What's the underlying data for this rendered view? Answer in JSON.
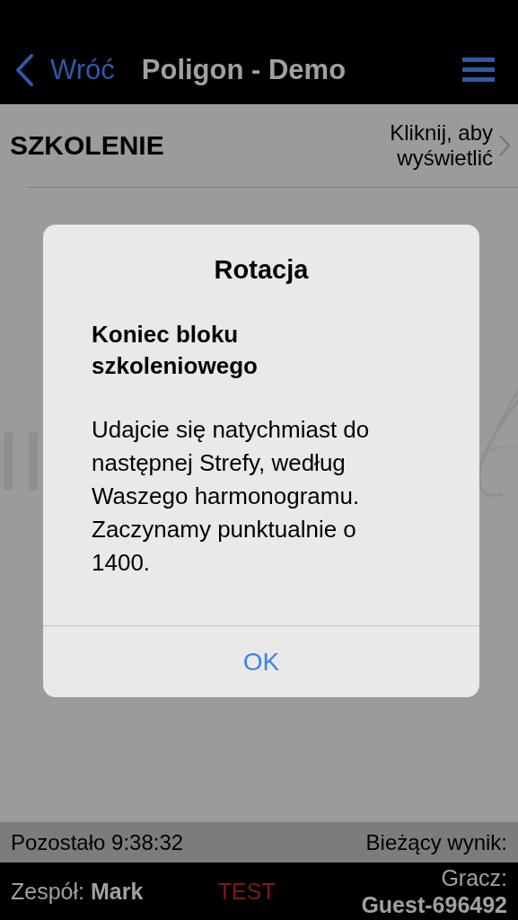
{
  "nav": {
    "back_label": "Wróć",
    "title": "Poligon - Demo"
  },
  "section": {
    "title": "SZKOLENIE",
    "action": "Kliknij, aby wyświetlić"
  },
  "dialog": {
    "title": "Rotacja",
    "heading": "Koniec bloku szkoleniowego",
    "message": "Udajcie się natychmiast do następnej Strefy, według Waszego harmonogramu. Zaczynamy punktualnie o 1400.",
    "buttons": [
      "OK"
    ]
  },
  "info_bar": {
    "time_left": "Pozostało 9:38:32",
    "score_label": "Bieżący wynik:"
  },
  "bottom_bar": {
    "team": "Zespół: **Mark**",
    "mode": "TEST",
    "player_label": "Gracz:",
    "player_name": "Guest-696492"
  }
}
